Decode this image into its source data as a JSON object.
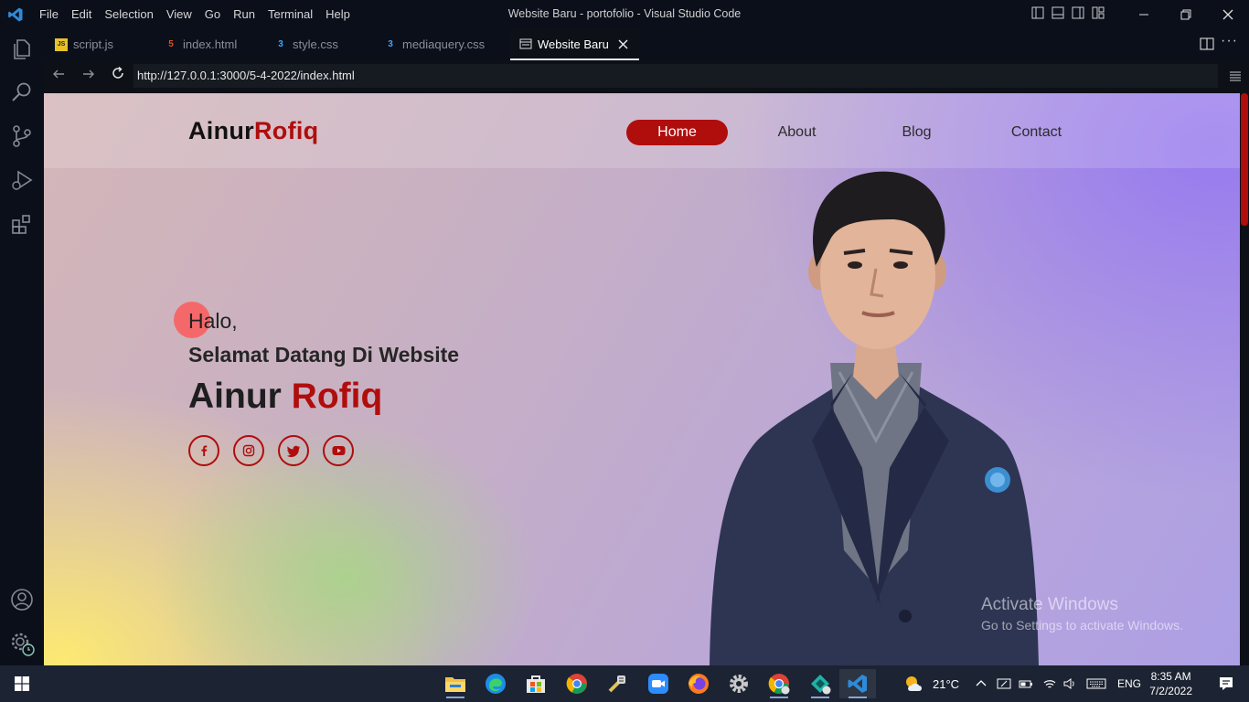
{
  "titlebar": {
    "menu": [
      "File",
      "Edit",
      "Selection",
      "View",
      "Go",
      "Run",
      "Terminal",
      "Help"
    ],
    "window_title": "Website Baru - portofolio - Visual Studio Code"
  },
  "tabs": [
    {
      "label": "script.js",
      "icon": "js-file-icon",
      "icon_color": "#e6c229"
    },
    {
      "label": "index.html",
      "icon": "html-file-icon",
      "icon_color": "#e44d26"
    },
    {
      "label": "style.css",
      "icon": "css-file-icon",
      "icon_color": "#42a5f5"
    },
    {
      "label": "mediaquery.css",
      "icon": "css-file-icon",
      "icon_color": "#42a5f5"
    },
    {
      "label": "Website Baru",
      "icon": "browser-preview-icon",
      "active": true
    }
  ],
  "browser": {
    "url": "http://127.0.0.1:3000/5-4-2022/index.html"
  },
  "site": {
    "brand_first": "Ainur",
    "brand_second": "Rofiq",
    "nav": [
      "Home",
      "About",
      "Blog",
      "Contact"
    ],
    "active_nav": "Home",
    "greeting": "Halo,",
    "welcome": "Selamat Datang Di Website",
    "name_first": "Ainur",
    "name_second": "Rofiq",
    "socials": [
      "facebook-icon",
      "instagram-icon",
      "twitter-icon",
      "youtube-icon"
    ],
    "accent_color": "#b00d0d"
  },
  "watermark": {
    "line1": "Activate Windows",
    "line2": "Go to Settings to activate Windows."
  },
  "taskbar": {
    "apps": [
      "file-explorer-icon",
      "edge-icon",
      "store-icon",
      "chrome-icon",
      "tool-icon",
      "zoom-icon",
      "firefox-icon",
      "settings-gear-icon",
      "chrome-profile-icon",
      "app-icon",
      "vscode-icon"
    ],
    "weather": "21°C",
    "language": "ENG",
    "time": "8:35 AM",
    "date": "7/2/2022"
  }
}
